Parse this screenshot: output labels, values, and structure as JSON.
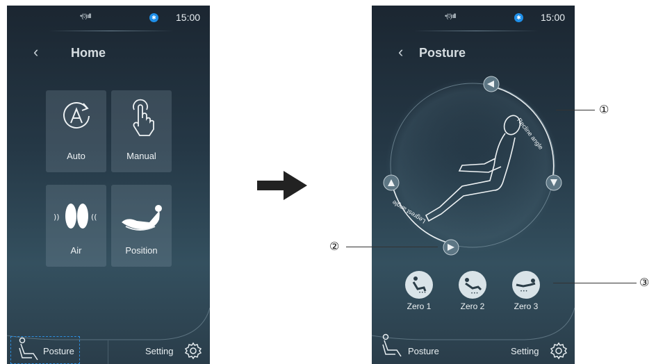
{
  "status": {
    "signal": "•(◊)ıılll",
    "bluetooth": "✱",
    "time": "15:00"
  },
  "home_screen": {
    "title": "Home",
    "tiles": [
      {
        "label": "Auto"
      },
      {
        "label": "Manual"
      },
      {
        "label": "Air"
      },
      {
        "label": "Position"
      }
    ],
    "nav": {
      "posture": "Posture",
      "setting": "Setting"
    }
  },
  "posture_screen": {
    "title": "Posture",
    "recline_label": "Recline angle",
    "legrest_label": "Legrest angle",
    "zero_buttons": [
      {
        "label": "Zero 1"
      },
      {
        "label": "Zero 2"
      },
      {
        "label": "Zero 3"
      }
    ],
    "nav": {
      "posture": "Posture",
      "setting": "Setting"
    }
  },
  "callouts": [
    "①",
    "②",
    "③"
  ],
  "colors": {
    "accent": "#2d8fe0",
    "screen_bg": "#253846"
  }
}
